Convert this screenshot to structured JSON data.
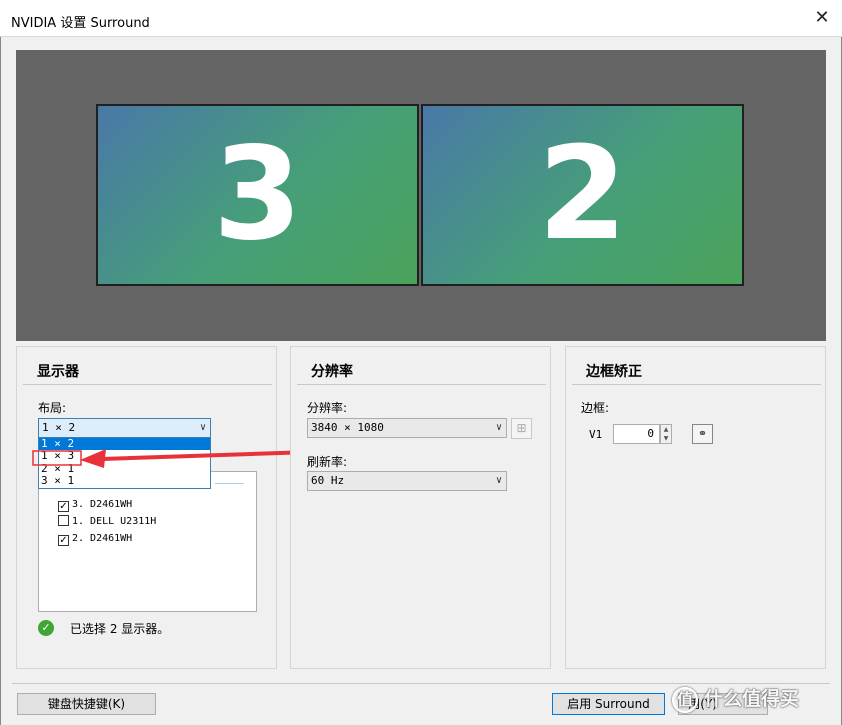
{
  "window": {
    "title": "NVIDIA 设置 Surround",
    "close_glyph": "✕"
  },
  "preview": {
    "monitors": [
      {
        "number": "3"
      },
      {
        "number": "2"
      }
    ]
  },
  "displays_panel": {
    "title": "显示器",
    "layout_label": "布局:",
    "layout_selected": "1 × 2",
    "layout_options": [
      "1 × 2",
      "1 × 3",
      "2 × 1",
      "3 × 1"
    ],
    "monitors": [
      {
        "label": "3. D2461WH",
        "checked": true
      },
      {
        "label": "1. DELL U2311H",
        "checked": false
      },
      {
        "label": "2. D2461WH",
        "checked": true
      }
    ],
    "status": "已选择 2 显示器。"
  },
  "resolution_panel": {
    "title": "分辨率",
    "resolution_label": "分辨率:",
    "resolution_value": "3840 × 1080",
    "refresh_label": "刷新率:",
    "refresh_value": "60 Hz"
  },
  "bezel_panel": {
    "title": "边框矫正",
    "bezel_label": "边框:",
    "v1_label": "V1",
    "v1_value": "0"
  },
  "footer": {
    "shortcut_button": "键盘快捷键(K)",
    "enable_button": "启用 Surround",
    "partial_button": "用(Y)",
    "watermark": "什么值得买",
    "watermark_badge": "值"
  },
  "colors": {
    "preview_bg": "#646464",
    "monitor_gradient_start": "#4a78a8",
    "monitor_gradient_end": "#4aa35a",
    "selection": "#0078d7",
    "ok_green": "#3fa534",
    "annotation_red": "#e8323a"
  },
  "icons": {
    "close": "close-icon",
    "chevron": "chevron-down-icon",
    "ok": "checkmark-circle-icon",
    "link": "chain-link-icon",
    "annotation": "red-arrow-annotation"
  }
}
